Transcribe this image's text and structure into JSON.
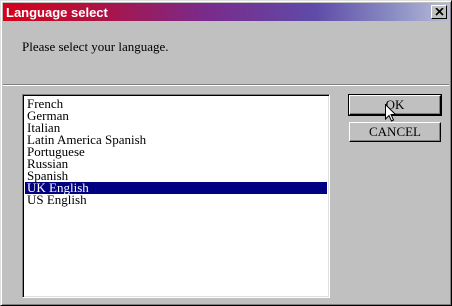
{
  "window": {
    "title": "Language select",
    "close_glyph": "✕"
  },
  "dialog": {
    "prompt": "Please select your language."
  },
  "languages": {
    "items": [
      "French",
      "German",
      "Italian",
      "Latin America Spanish",
      "Portuguese",
      "Russian",
      "Spanish",
      "UK English",
      "US English"
    ],
    "selected": "UK English"
  },
  "buttons": {
    "ok_label": "OK",
    "cancel_label": "CANCEL"
  },
  "colors": {
    "title_gradient_start": "#d6001c",
    "title_gradient_end": "#b8bcd8",
    "selection": "#000080"
  }
}
